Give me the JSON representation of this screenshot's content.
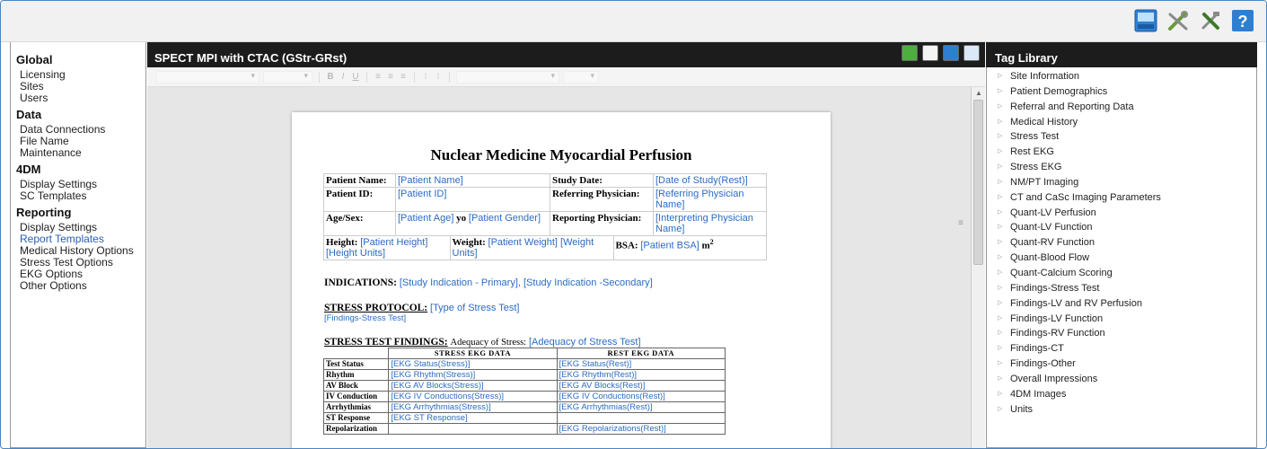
{
  "sidebar": {
    "groups": [
      {
        "title": "Global",
        "items": [
          "Licensing",
          "Sites",
          "Users"
        ]
      },
      {
        "title": "Data",
        "items": [
          "Data Connections",
          "File Name",
          "Maintenance"
        ]
      },
      {
        "title": "4DM",
        "items": [
          "Display Settings",
          "SC Templates"
        ]
      },
      {
        "title": "Reporting",
        "items": [
          "Display Settings",
          "Report Templates",
          "Medical History Options",
          "Stress Test Options",
          "EKG Options",
          "Other Options"
        ]
      }
    ],
    "active_item": "Report Templates"
  },
  "main": {
    "title": "SPECT MPI with CTAC (GStr-GRst)"
  },
  "report": {
    "title": "Nuclear Medicine Myocardial Perfusion",
    "patient_name_label": "Patient Name:",
    "patient_name_tag": "[Patient Name]",
    "study_date_label": "Study Date:",
    "study_date_tag": "[Date of Study(Rest)]",
    "patient_id_label": "Patient ID:",
    "patient_id_tag": "[Patient ID]",
    "referring_label": "Referring Physician:",
    "referring_tag": "[Referring Physician Name]",
    "agesex_label": "Age/Sex:",
    "age_tag": "[Patient Age]",
    "yo": " yo ",
    "gender_tag": "[Patient Gender]",
    "reporting_label": "Reporting Physician:",
    "reporting_tag": "[Interpreting Physician Name]",
    "height_label": "Height:",
    "height_tag": "[Patient Height] [Height Units]",
    "weight_label": "Weight:",
    "weight_tag": "[Patient Weight] [Weight Units]",
    "bsa_label": "BSA:",
    "bsa_tag": "[Patient BSA]",
    "bsa_unit": "m",
    "bsa_sup": "2",
    "indications_label": "INDICATIONS:",
    "indications_tag": "[Study Indication - Primary], [Study Indication -Secondary]",
    "stress_protocol_label": "STRESS PROTOCOL:",
    "stress_protocol_tag": "[Type of Stress Test]",
    "stress_protocol_sub": "[Findings-Stress Test]",
    "findings_label": "STRESS TEST FINDINGS:",
    "adequacy_label": "Adequacy of Stress:",
    "adequacy_tag": "[Adequacy of Stress Test]",
    "ekg_headers": [
      "STRESS EKG DATA",
      "REST EKG DATA"
    ],
    "ekg_rows": [
      {
        "label": "Test Status",
        "stress": "[EKG Status(Stress)]",
        "rest": "[EKG Status(Rest)]"
      },
      {
        "label": "Rhythm",
        "stress": "[EKG Rhythm(Stress)]",
        "rest": "[EKG Rhythm(Rest)]"
      },
      {
        "label": "AV Block",
        "stress": "[EKG AV Blocks(Stress)]",
        "rest": "[EKG AV Blocks(Rest)]"
      },
      {
        "label": "IV Conduction",
        "stress": "[EKG IV Conductions(Stress)]",
        "rest": "[EKG IV Conductions(Rest)]"
      },
      {
        "label": "Arrhythmias",
        "stress": "[EKG Arrhythmias(Stress)]",
        "rest": "[EKG Arrhythmias(Rest)]"
      },
      {
        "label": "ST Response",
        "stress": "[EKG ST Response]",
        "rest": ""
      },
      {
        "label": "Repolarization",
        "stress": "",
        "rest": "[EKG Repolarizations(Rest)]"
      }
    ]
  },
  "tag_library": {
    "title": "Tag Library",
    "items": [
      "Site Information",
      "Patient Demographics",
      "Referral and Reporting Data",
      "Medical History",
      "Stress Test",
      "Rest EKG",
      "Stress EKG",
      "NM/PT Imaging",
      "CT and CaSc Imaging Parameters",
      "Quant-LV Perfusion",
      "Quant-LV Function",
      "Quant-RV Function",
      "Quant-Blood Flow",
      "Quant-Calcium Scoring",
      "Findings-Stress Test",
      "Findings-LV and RV Perfusion",
      "Findings-LV Function",
      "Findings-RV Function",
      "Findings-CT",
      "Findings-Other",
      "Overall Impressions",
      "4DM Images",
      "Units"
    ]
  },
  "top_icons": [
    "save-icon",
    "tools-icon",
    "settings-tools-icon",
    "help-icon"
  ],
  "head_icons": [
    "download-icon",
    "document-icon",
    "save-icon",
    "export-icon"
  ],
  "help_glyph": "?",
  "colors": {
    "accent": "#2b6cc4",
    "header_bg": "#1c1c1c",
    "link_active": "#2a5db0"
  }
}
